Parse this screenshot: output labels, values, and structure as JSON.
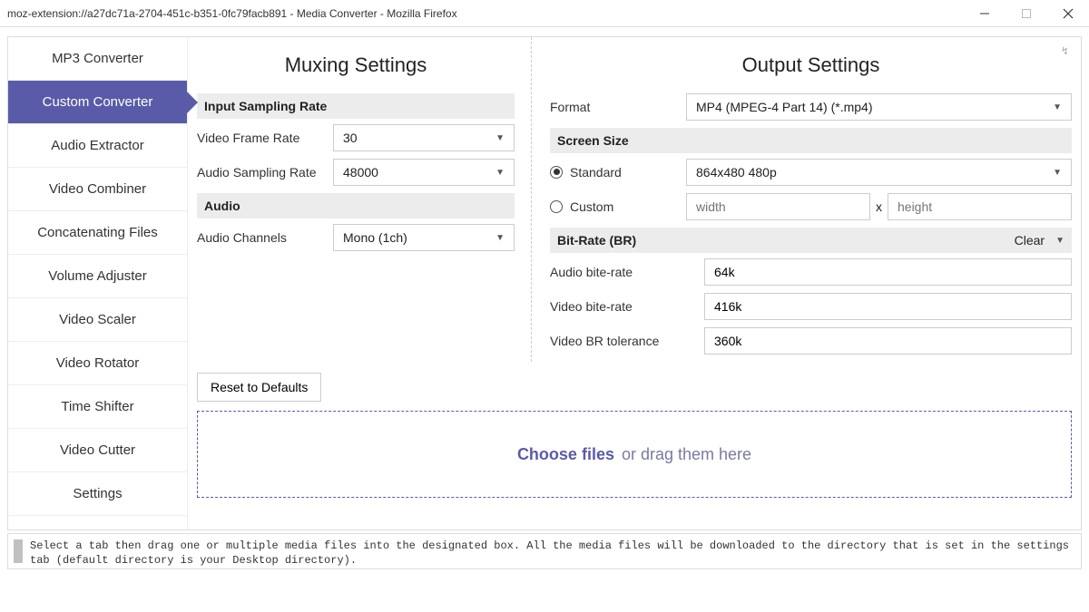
{
  "window": {
    "title": "moz-extension://a27dc71a-2704-451c-b351-0fc79facb891 - Media Converter - Mozilla Firefox",
    "net_badge": "↯"
  },
  "sidebar": {
    "items": [
      "MP3 Converter",
      "Custom Converter",
      "Audio Extractor",
      "Video Combiner",
      "Concatenating Files",
      "Volume Adjuster",
      "Video Scaler",
      "Video Rotator",
      "Time Shifter",
      "Video Cutter",
      "Settings"
    ],
    "active_index": 1
  },
  "muxing": {
    "heading": "Muxing Settings",
    "section_input": "Input Sampling Rate",
    "video_fr_label": "Video Frame Rate",
    "video_fr_value": "30",
    "audio_sr_label": "Audio Sampling Rate",
    "audio_sr_value": "48000",
    "section_audio": "Audio",
    "audio_ch_label": "Audio Channels",
    "audio_ch_value": "Mono (1ch)"
  },
  "output": {
    "heading": "Output Settings",
    "format_label": "Format",
    "format_value": "MP4 (MPEG-4 Part 14) (*.mp4)",
    "section_screen": "Screen Size",
    "standard_label": "Standard",
    "standard_value": "864x480 480p",
    "custom_label": "Custom",
    "width_ph": "width",
    "x_label": "x",
    "height_ph": "height",
    "section_bitrate": "Bit-Rate (BR)",
    "clear_label": "Clear",
    "audio_br_label": "Audio bite-rate",
    "audio_br_value": "64k",
    "video_br_label": "Video bite-rate",
    "video_br_value": "416k",
    "video_brt_label": "Video BR tolerance",
    "video_brt_value": "360k"
  },
  "actions": {
    "reset_label": "Reset to Defaults",
    "choose_label": "Choose files",
    "drag_label": "or drag them here"
  },
  "status": {
    "text": "Select a tab then drag one or multiple media files into the designated box. All the media files will be downloaded to the directory that is set in the settings tab (default directory is your Desktop directory)."
  }
}
